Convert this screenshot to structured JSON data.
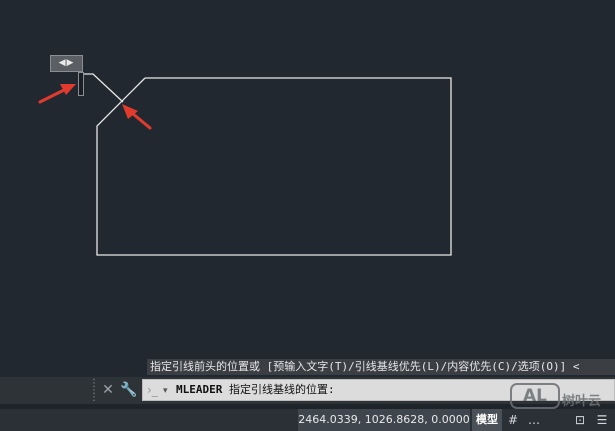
{
  "canvas": {
    "background": "#212830",
    "line_color": "#e8e8e8",
    "arrow_color": "#e23b2e",
    "grip_glyph": "◀▶"
  },
  "command_line": {
    "history_text": "指定引线前头的位置或 [预输入文字(T)/引线基线优先(L)/内容优先(C)/选项(O)] <",
    "command_name": "MLEADER",
    "prompt_text": "指定引线基线的位置:",
    "close_glyph": "✕",
    "customize_glyph": "🔧",
    "recent_glyph": "▾"
  },
  "status_bar": {
    "coordinates": "2464.0339, 1026.8628, 0.0000",
    "model_tab_label": "模型",
    "grid_glyph": "#",
    "more_glyph": "…",
    "workspace_glyph": "⊡"
  },
  "watermark": {
    "logo_text": "AL",
    "brand_text": "树叶云"
  }
}
